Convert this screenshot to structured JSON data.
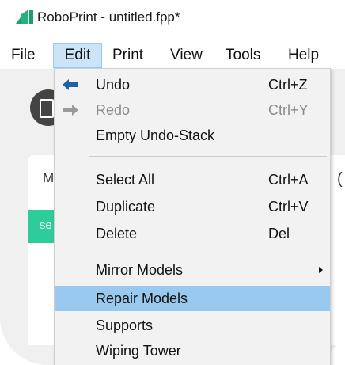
{
  "window": {
    "title": "RoboPrint - untitled.fpp*"
  },
  "menubar": {
    "items": [
      "File",
      "Edit",
      "Print",
      "View",
      "Tools",
      "Help"
    ],
    "active": "Edit"
  },
  "background": {
    "panel_label": "M",
    "panel_bar_text": "se",
    "right_edge_char": "("
  },
  "edit_menu": {
    "undo": {
      "label": "Undo",
      "shortcut": "Ctrl+Z",
      "icon": "arrow-left-icon"
    },
    "redo": {
      "label": "Redo",
      "shortcut": "Ctrl+Y",
      "icon": "arrow-right-icon",
      "disabled": true
    },
    "empty_undo_stack": {
      "label": "Empty Undo-Stack"
    },
    "select_all": {
      "label": "Select All",
      "shortcut": "Ctrl+A"
    },
    "duplicate": {
      "label": "Duplicate",
      "shortcut": "Ctrl+V"
    },
    "delete": {
      "label": "Delete",
      "shortcut": "Del"
    },
    "mirror_models": {
      "label": "Mirror Models",
      "has_submenu": true
    },
    "repair_models": {
      "label": "Repair Models",
      "highlighted": true
    },
    "supports": {
      "label": "Supports"
    },
    "wiping_tower": {
      "label": "Wiping Tower"
    }
  },
  "colors": {
    "menu_highlight": "#99c9ef",
    "menubar_active": "#cce4f7",
    "accent_green": "#2ecc9a",
    "icon_blue": "#1f5fa8",
    "disabled_text": "#8c8c8c"
  }
}
